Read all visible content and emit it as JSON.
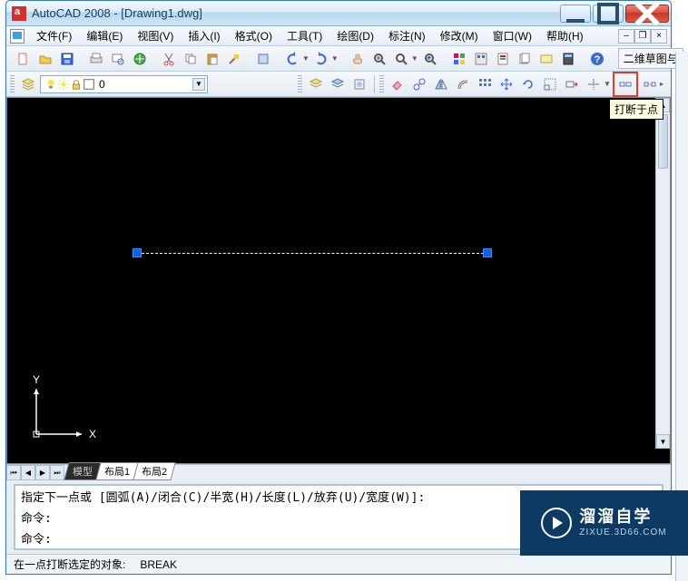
{
  "title": "AutoCAD 2008 - [Drawing1.dwg]",
  "menus": {
    "file": "文件(F)",
    "edit": "编辑(E)",
    "view": "视图(V)",
    "insert": "插入(I)",
    "format": "格式(O)",
    "tools": "工具(T)",
    "draw": "绘图(D)",
    "dimension": "标注(N)",
    "modify": "修改(M)",
    "window": "窗口(W)",
    "help": "帮助(H)"
  },
  "layer": {
    "current": "0"
  },
  "toolbar_tab": "二维草图与",
  "tooltip_break": "打断于点",
  "tabs": {
    "model": "模型",
    "layout1": "布局1",
    "layout2": "布局2"
  },
  "cmd": {
    "line1": "指定下一点或 [圆弧(A)/闭合(C)/半宽(H)/长度(L)/放弃(U)/宽度(W)]:",
    "line2": "命令:",
    "line3": "命令:"
  },
  "status": {
    "hint": "在一点打断选定的对象:",
    "cmd": "BREAK"
  },
  "axis": {
    "x": "X",
    "y": "Y"
  },
  "watermark": {
    "name": "溜溜自学",
    "sub": "ZIXUE.3D66.COM"
  }
}
